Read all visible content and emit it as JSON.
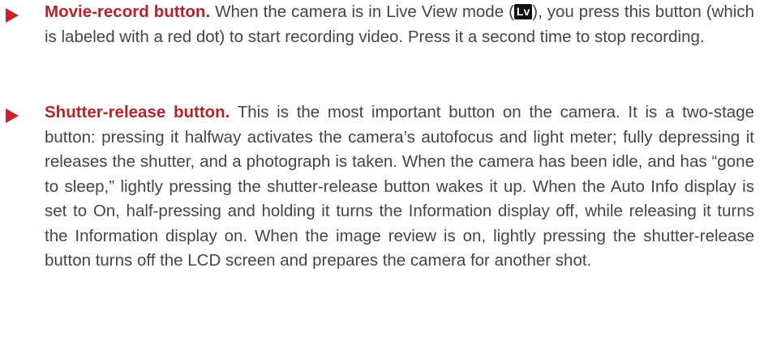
{
  "items": [
    {
      "term": "Movie-record button.",
      "text_before_icon": " When the camera is in Live View mode (",
      "icon_label": "Lv",
      "text_after_icon": "), you press this button (which is labeled with a red dot) to start recording video. Press it a second time to stop recording."
    },
    {
      "term": "Shutter-release button.",
      "text": " This is the most important button on the camera. It is a two-stage button: pressing it halfway activates the camera’s autofocus and light meter; fully depressing it releases the shutter, and a photograph is taken. When the camera has been idle, and has “gone to sleep,” lightly pressing the shutter-release button wakes it up. When the Auto Info display is set to On, half-pressing and holding it turns the Information display off, while releasing it turns the Information display on. When the image review is on, lightly pressing the shutter-release button turns off the LCD screen and prepares the camera for another shot."
    }
  ],
  "colors": {
    "term": "#b5232a",
    "bullet": "#c8212a",
    "body_text": "#454545"
  },
  "icons": {
    "bullet": "red-triangle-bullet-icon",
    "live_view": "live-view-icon"
  }
}
